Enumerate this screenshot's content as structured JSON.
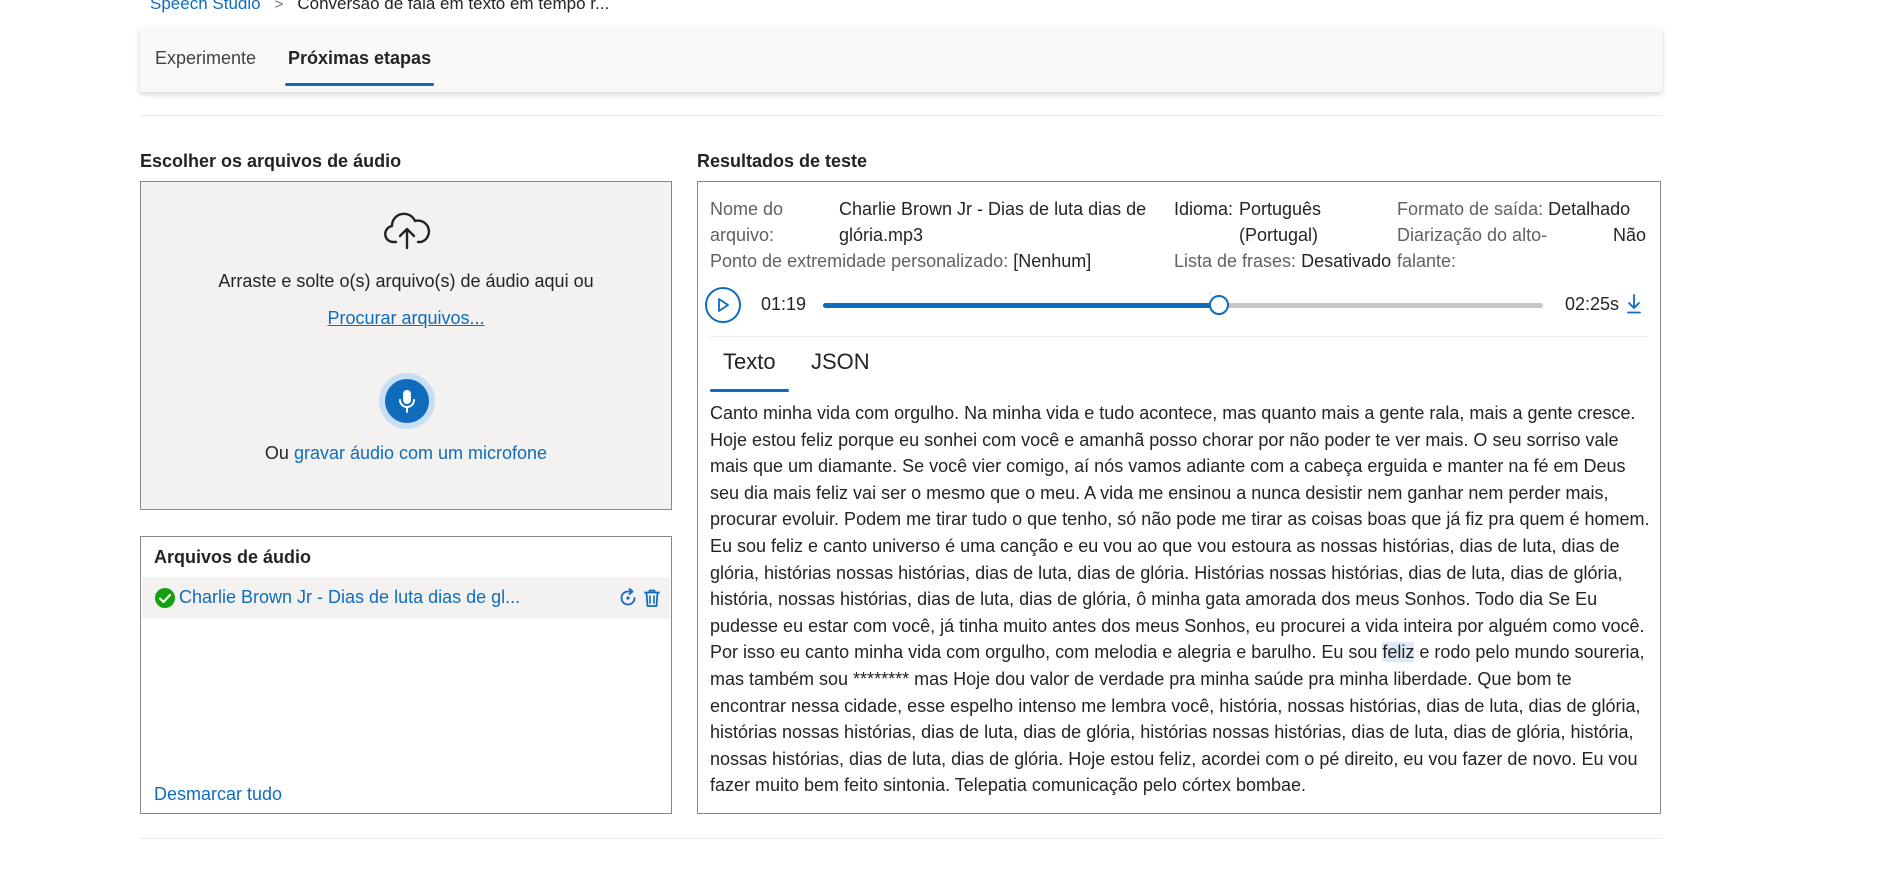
{
  "breadcrumb": {
    "root": "Speech Studio",
    "separator": ">",
    "current": "Conversão de fala em texto em tempo r..."
  },
  "tabs": [
    {
      "label": "Experimente"
    },
    {
      "label": "Próximas etapas",
      "active": true
    }
  ],
  "upload": {
    "title": "Escolher os arquivos de áudio",
    "drop_text": "Arraste e solte o(s) arquivo(s) de áudio aqui ou",
    "browse_link": "Procurar arquivos...",
    "mic_prefix": "Ou",
    "mic_link": "gravar áudio com um microfone"
  },
  "files": {
    "title": "Arquivos de áudio",
    "items": [
      {
        "name": "Charlie Brown Jr - Dias de luta dias de gl...",
        "status": "success"
      }
    ],
    "unselect_all": "Desmarcar tudo"
  },
  "results": {
    "title": "Resultados de teste",
    "file_name_label_1": "Nome do",
    "file_name_label_2": "arquivo:",
    "file_name_value_1": "Charlie Brown Jr - Dias de luta dias de",
    "file_name_value_2": "glória.mp3",
    "endpoint_label": "Ponto de extremidade personalizado:",
    "endpoint_value": "[Nenhum]",
    "language_label": "Idioma:",
    "language_value_1": "Português",
    "language_value_2": "(Portugal)",
    "phrase_list_label": "Lista de frases:",
    "phrase_list_value": "Desativado",
    "output_format_label": "Formato de saída:",
    "output_format_value": "Detalhado",
    "diarization_label_1": "Diarização do alto-",
    "diarization_label_2": "falante:",
    "diarization_value": "Não",
    "player": {
      "current_time": "01:19",
      "total_time": "02:25s",
      "progress_fraction": 0.55
    },
    "tabs": [
      {
        "label": "Texto",
        "active": true
      },
      {
        "label": "JSON"
      }
    ],
    "transcript_before": "Canto minha vida com orgulho. Na minha vida e tudo acontece, mas quanto mais a gente rala, mais a gente cresce. Hoje estou feliz porque eu sonhei com você e amanhã posso chorar por não poder te ver mais. O seu sorriso vale mais que um diamante. Se você vier comigo, aí nós vamos adiante com a cabeça erguida e manter na fé em Deus seu dia mais feliz vai ser o mesmo que o meu. A vida me ensinou a nunca desistir nem ganhar nem perder mais, procurar evoluir. Podem me tirar tudo o que tenho, só não pode me tirar as coisas boas que já fiz pra quem é homem. Eu sou feliz e canto universo é uma canção e eu vou ao que vou estoura as nossas histórias, dias de luta, dias de glória, histórias nossas histórias, dias de luta, dias de glória. Histórias nossas histórias, dias de luta, dias de glória, história, nossas histórias, dias de luta, dias de glória, ô minha gata amorada dos meus Sonhos. Todo dia Se Eu pudesse eu estar com você, já tinha muito antes dos meus Sonhos, eu procurei a vida inteira por alguém como você. Por isso eu canto minha vida com orgulho, com melodia e alegria e barulho. Eu sou ",
    "transcript_highlight": "feliz",
    "transcript_after": " e rodo pelo mundo soureria, mas também sou ******** mas Hoje dou valor de verdade pra minha saúde pra minha liberdade. Que bom te encontrar nessa cidade, esse espelho intenso me lembra você, história, nossas histórias, dias de luta, dias de glória, histórias nossas histórias, dias de luta, dias de glória, histórias nossas histórias, dias de luta, dias de glória, história, nossas histórias, dias de luta, dias de glória. Hoje estou feliz, acordei com o pé direito, eu vou fazer de novo. Eu vou fazer muito bem feito sintonia. Telepatia comunicação pelo córtex bombae."
  },
  "colors": {
    "accent": "#0f6cbd",
    "success": "#13a10e",
    "panel_bg": "#f3f2f1"
  },
  "icons": {
    "upload": "cloud-upload-icon",
    "mic": "microphone-icon",
    "check": "check-circle-icon",
    "retry": "retry-icon",
    "delete": "trash-icon",
    "play": "play-icon",
    "download": "download-icon"
  }
}
